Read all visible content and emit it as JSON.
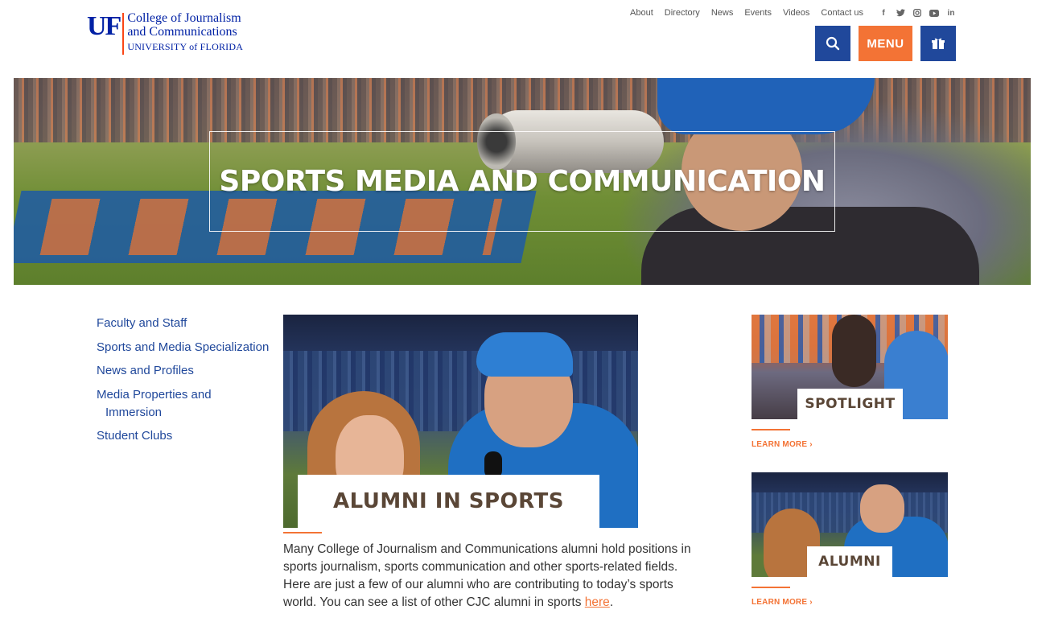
{
  "logo": {
    "mark": "UF",
    "line1": "College of Journalism",
    "line2": "and Communications",
    "line3": "UNIVERSITY of FLORIDA"
  },
  "topnav": {
    "links": [
      "About",
      "Directory",
      "News",
      "Events",
      "Videos",
      "Contact us"
    ],
    "social": [
      "facebook-icon",
      "twitter-icon",
      "instagram-icon",
      "youtube-icon",
      "linkedin-icon"
    ]
  },
  "actions": {
    "search_icon": "search-icon",
    "menu_label": "MENU",
    "gift_icon": "gift-icon"
  },
  "hero": {
    "title": "SPORTS MEDIA AND COMMUNICATION"
  },
  "sidebar": {
    "items": [
      {
        "label": "Faculty and Staff"
      },
      {
        "label": "Sports and Media Specialization"
      },
      {
        "label": "News and Profiles"
      },
      {
        "label_line1": "Media Properties and",
        "label_line2": "Immersion"
      },
      {
        "label": "Student Clubs"
      }
    ]
  },
  "main": {
    "image_label": "ALUMNI IN SPORTS",
    "paragraph": "Many College of Journalism and Communications alumni hold positions in sports journalism, sports communication and other sports-related fields. Here are just a few of our alumni who are contributing to today’s sports world.  You can see a list of other CJC alumni in sports ",
    "link_text": "here",
    "paragraph_end": "."
  },
  "cards": [
    {
      "label": "SPOTLIGHT",
      "link": "LEARN MORE ›"
    },
    {
      "label": "ALUMNI",
      "link": "LEARN MORE ›"
    }
  ],
  "colors": {
    "uf_blue": "#0021a5",
    "nav_blue": "#20489b",
    "orange": "#f37335"
  }
}
